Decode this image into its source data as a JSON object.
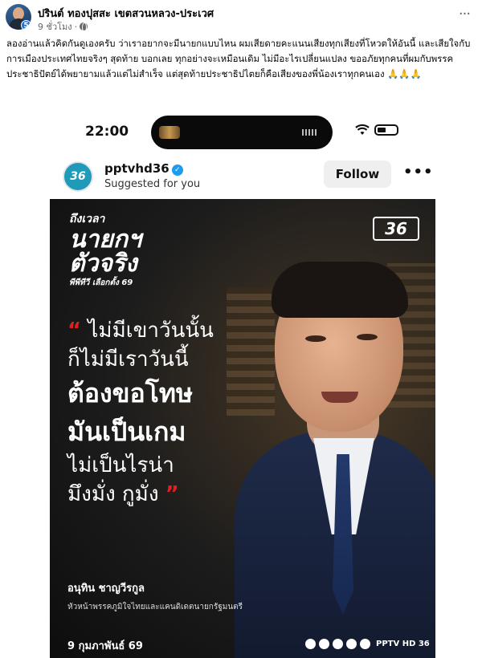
{
  "post": {
    "author": "ปรินต์ ทองปุสสะ เขตสวนหลวง-ประเวศ",
    "time": "9 ชั่วโมง",
    "avatar_badge": "5",
    "text": "ลองอ่านแล้วคิดกันดูเองครับ ว่าเราอยากจะมีนายกแบบไหน ผมเสียดายคะแนนเสียงทุกเสียงที่โหวตให้อันนี้ และเสียใจกับการเมืองประเทศไทยจริงๆ สุดท้าย บอกเลย ทุกอย่างจะเหมือนเดิม ไม่มีอะไรเปลี่ยนแปลง ขออภัยทุกคนที่ผมกับพรรคประชาธิปัตย์ได้พยายามแล้วแต่ไม่สำเร็จ แต่สุดท้ายประชาธิปไตยก็คือเสียงของพี่น้องเราทุกคนเอง 🙏🙏🙏"
  },
  "phone": {
    "clock": "22:00"
  },
  "ig": {
    "username": "pptvhd36",
    "subtitle": "Suggested for you",
    "follow_label": "Follow",
    "avatar_text": "36"
  },
  "poster": {
    "show_line1": "ถึงเวลา",
    "show_line2": "นายกฯ",
    "show_line3": "ตัวจริง",
    "show_line4": "พีพีทีวี เลือกตั้ง 69",
    "channel_logo": "36",
    "quote_open": "“",
    "quote_close": "”",
    "quote_lines": [
      "ไม่มีเขาวันนั้น",
      "ก็ไม่มีเราวันนี้",
      "ต้องขอโทษ",
      "มันเป็นเกม",
      "ไม่เป็นไรน่า",
      "มึงมั่ง กูมั่ง"
    ],
    "speaker_name": "อนุทิน ชาญวีรกูล",
    "speaker_title": "หัวหน้าพรรคภูมิใจไทยและแคนดิเดตนายกรัฐมนตรี",
    "date": "9 กุมภาพันธ์ 69",
    "social_handle": "PPTV HD 36"
  },
  "colors": {
    "quote_mark": "#e02020",
    "fb_meta": "#65676b",
    "verified": "#1d9bf0"
  }
}
